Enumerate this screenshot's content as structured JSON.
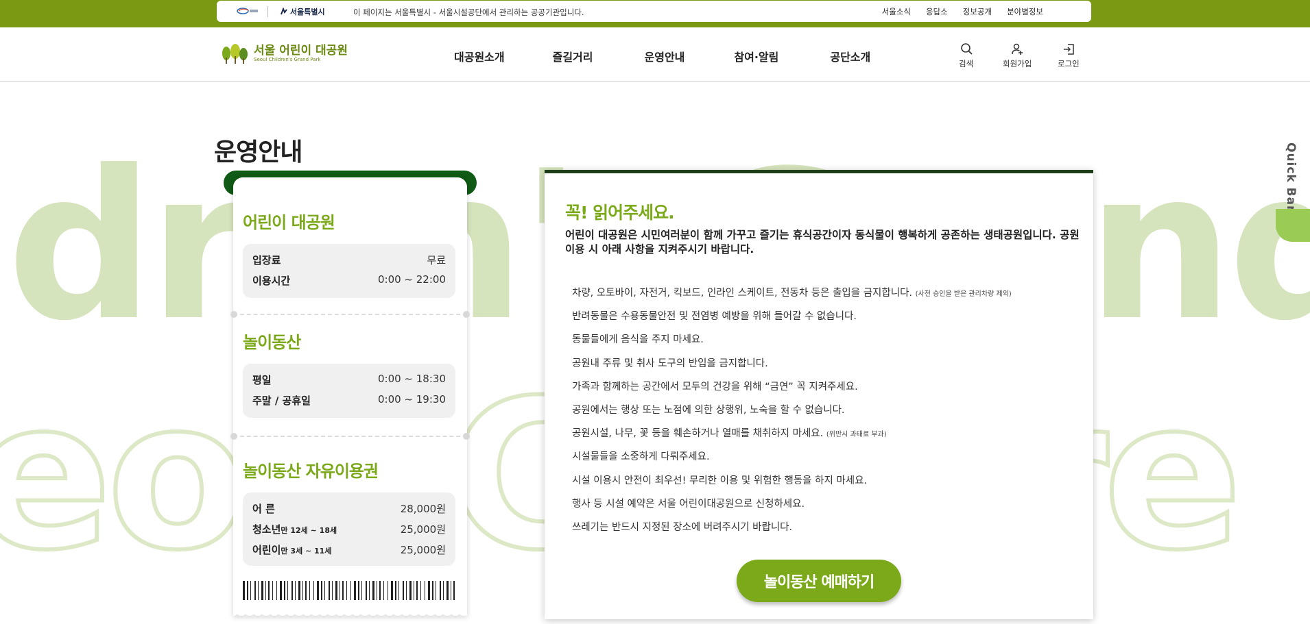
{
  "topbar": {
    "logo1_label": "서울시",
    "logo2_label": "서울특별시",
    "notice": "이 페이지는 서울특별시 - 서울시설공단에서 관리하는 공공기관입니다.",
    "links": [
      "서울소식",
      "응답소",
      "정보공개",
      "분야별정보"
    ]
  },
  "header": {
    "logo_title": "서울 어린이 대공원",
    "logo_subtitle": "Seoul Children's Grand Park",
    "nav": [
      "대공원소개",
      "즐길거리",
      "운영안내",
      "참여·알림",
      "공단소개"
    ],
    "icons": [
      {
        "label": "검색",
        "icon": "search-icon"
      },
      {
        "label": "회원가입",
        "icon": "user-add-icon"
      },
      {
        "label": "로그인",
        "icon": "login-icon"
      }
    ]
  },
  "background_text": {
    "line1": "dren'sGrand",
    "line2": "eoulChildre"
  },
  "page": {
    "title": "운영안내"
  },
  "ticket": {
    "sections": [
      {
        "title": "어린이 대공원",
        "rows": [
          {
            "label": "입장료",
            "value": "무료"
          },
          {
            "label": "이용시간",
            "value": "0:00 ~ 22:00"
          }
        ]
      },
      {
        "title": "놀이동산",
        "rows": [
          {
            "label": "평일",
            "value": "0:00 ~ 18:30"
          },
          {
            "label": "주말 / 공휴일",
            "value": "0:00 ~ 19:30"
          }
        ]
      },
      {
        "title": "놀이동산 자유이용권",
        "rows": [
          {
            "label": "어 른",
            "note": "",
            "value": "28,000원"
          },
          {
            "label": "청소년",
            "note": "만 12세 ~ 18세",
            "value": "25,000원"
          },
          {
            "label": "어린이",
            "note": "만 3세 ~ 11세",
            "value": "25,000원"
          }
        ]
      }
    ]
  },
  "notice": {
    "title": "꼭! 읽어주세요.",
    "intro": "어린이 대공원은 시민여러분이 함께 가꾸고 즐기는 휴식공간이자 동식물이 행복하게 공존하는 생태공원입니다. 공원이용 시 아래 사항을 지켜주시기 바랍니다.",
    "rules": [
      {
        "text": "차량, 오토바이, 자전거, 킥보드, 인라인 스케이트, 전동차 등은 출입을 금지합니다.",
        "note": "(사전 승인을 받은 관리차량 제외)"
      },
      {
        "text": "반려동물은 수용동물안전 및 전염병 예방을 위해 들어갈 수 없습니다.",
        "note": ""
      },
      {
        "text": "동물들에게 음식을 주지 마세요.",
        "note": ""
      },
      {
        "text": "공원내 주류 및 취사 도구의 반입을 금지합니다.",
        "note": ""
      },
      {
        "text": "가족과 함께하는 공간에서 모두의 건강을 위해 “금연” 꼭 지켜주세요.",
        "note": ""
      },
      {
        "text": "공원에서는 행상 또는 노점에 의한 상행위, 노숙을 할 수 없습니다.",
        "note": ""
      },
      {
        "text": "공원시설, 나무, 꽃 등을 훼손하거나 열매를 채취하지 마세요.",
        "note": "(위반시 과태료 부과)"
      },
      {
        "text": "시설물들을 소중하게 다뤄주세요.",
        "note": ""
      },
      {
        "text": "시설 이용시 안전이 최우선! 무리한 이용 및 위험한 행동을 하지 마세요.",
        "note": ""
      },
      {
        "text": "행사 등 시설 예약은 서울 어린이대공원으로 신청하세요.",
        "note": ""
      },
      {
        "text": "쓰레기는 반드시 지정된 장소에 버려주시기 바랍니다.",
        "note": ""
      }
    ],
    "cta": "놀이동산 예매하기"
  },
  "quickbar": {
    "label": "Quick Bar"
  },
  "colors": {
    "brand_green": "#7ba91a",
    "topbar_green": "#7b9a14",
    "dark_green": "#0f5a14",
    "quickbar_green": "#9acc55"
  }
}
